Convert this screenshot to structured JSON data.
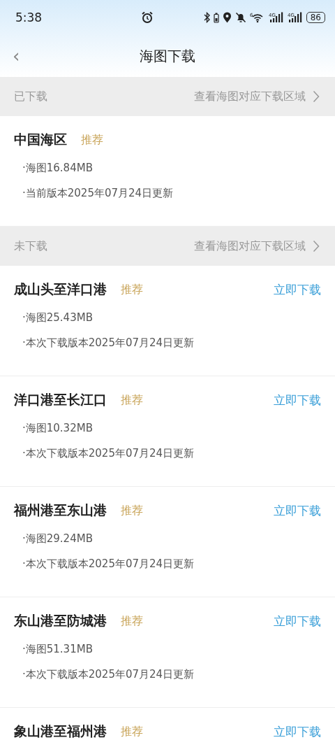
{
  "status_bar": {
    "time": "5:38",
    "wifi_label": "6",
    "signal_labels": [
      "4G",
      "4G"
    ],
    "battery": "86"
  },
  "header": {
    "back": "‹",
    "title": "海图下载"
  },
  "sections": [
    {
      "title": "已下载",
      "link": "查看海图对应下载区域",
      "items": [
        {
          "name": "中国海区",
          "tag": "推荐",
          "details": [
            "·海图16.84MB",
            "·当前版本2025年07月24日更新"
          ]
        }
      ]
    },
    {
      "title": "未下载",
      "link": "查看海图对应下载区域",
      "items": [
        {
          "name": "成山头至洋口港",
          "tag": "推荐",
          "action": "立即下载",
          "details": [
            "·海图25.43MB",
            "·本次下载版本2025年07月24日更新"
          ]
        },
        {
          "name": "洋口港至长江口",
          "tag": "推荐",
          "action": "立即下载",
          "details": [
            "·海图10.32MB",
            "·本次下载版本2025年07月24日更新"
          ]
        },
        {
          "name": "福州港至东山港",
          "tag": "推荐",
          "action": "立即下载",
          "details": [
            "·海图29.24MB",
            "·本次下载版本2025年07月24日更新"
          ]
        },
        {
          "name": "东山港至防城港",
          "tag": "推荐",
          "action": "立即下载",
          "details": [
            "·海图51.31MB",
            "·本次下载版本2025年07月24日更新"
          ]
        },
        {
          "name": "象山港至福州港",
          "tag": "推荐",
          "action": "立即下载"
        }
      ]
    }
  ]
}
